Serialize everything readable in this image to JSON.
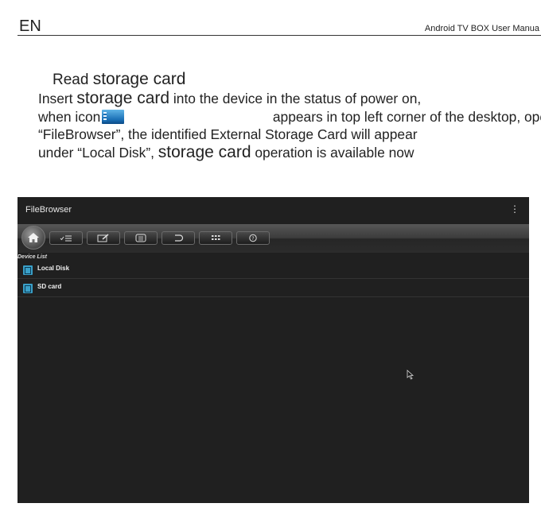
{
  "header": {
    "lang": "EN",
    "manual_title": "Android TV BOX User Manua"
  },
  "section": {
    "title_prefix": "Read",
    "title_emph": "storage card",
    "line1_a": "Insert",
    "line1_emph": "storage card",
    "line1_b": "into the device in the status of power on,",
    "line2_a": "when icon",
    "line2_b": "appears in top left corner of the desktop, ope",
    "line3": "“FileBrowser”, the identified External Storage Card will appear",
    "line4_a": "under “Local Disk”,",
    "line4_emph": "storage card",
    "line4_b": "operation is available now"
  },
  "app": {
    "title": "FileBrowser",
    "menu_icon": "overflow-menu-icon",
    "toolbar_icons": [
      "home-icon",
      "multi-select-icon",
      "edit-icon",
      "list-icon",
      "back-icon",
      "grid-icon",
      "help-icon"
    ],
    "device_list_label": "Device List",
    "devices": [
      {
        "label": "Local Disk",
        "icon": "disk-icon"
      },
      {
        "label": "SD card",
        "icon": "disk-icon"
      }
    ],
    "colors": {
      "background": "#202020",
      "row_icon": "#3aa0c8"
    }
  }
}
